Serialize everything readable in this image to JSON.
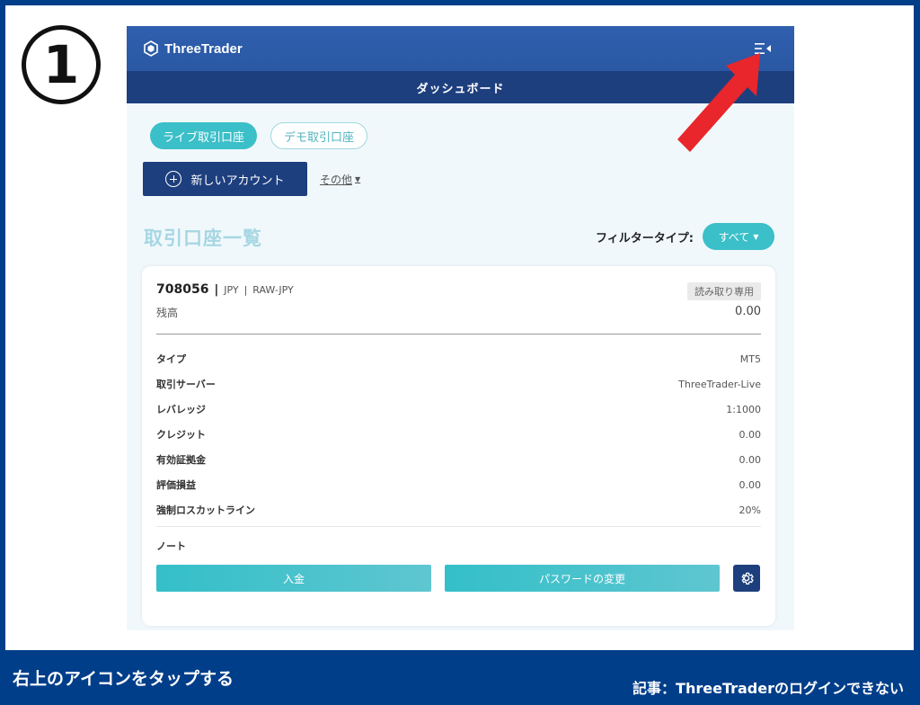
{
  "step_number": "1",
  "app": {
    "brand": "ThreeTrader",
    "page_title": "ダッシュボード"
  },
  "tabs": {
    "live": "ライブ取引口座",
    "demo": "デモ取引口座"
  },
  "actions": {
    "new_account": "新しいアカウント",
    "other": "その他"
  },
  "section": {
    "title": "取引口座一覧",
    "filter_label": "フィルタータイプ:",
    "filter_value": "すべて"
  },
  "account": {
    "number": "708056",
    "currency": "JPY",
    "type_code": "RAW-JPY",
    "badge": "読み取り専用",
    "balance_label": "残高",
    "balance_value": "0.00",
    "rows": [
      {
        "label": "タイプ",
        "value": "MT5"
      },
      {
        "label": "取引サーバー",
        "value": "ThreeTrader-Live"
      },
      {
        "label": "レバレッジ",
        "value": "1:1000"
      },
      {
        "label": "クレジット",
        "value": "0.00"
      },
      {
        "label": "有効証拠金",
        "value": "0.00"
      },
      {
        "label": "評価損益",
        "value": "0.00"
      },
      {
        "label": "強制ロスカットライン",
        "value": "20%"
      }
    ],
    "note_label": "ノート",
    "deposit_button": "入金",
    "password_button": "パスワードの変更"
  },
  "caption": "右上のアイコンをタップする",
  "credit": "記事：ThreeTraderのログインできない",
  "colors": {
    "navy": "#1e3f7e",
    "teal": "#3bbfc8",
    "arrow": "#e8262b",
    "frame": "#003e8a"
  }
}
